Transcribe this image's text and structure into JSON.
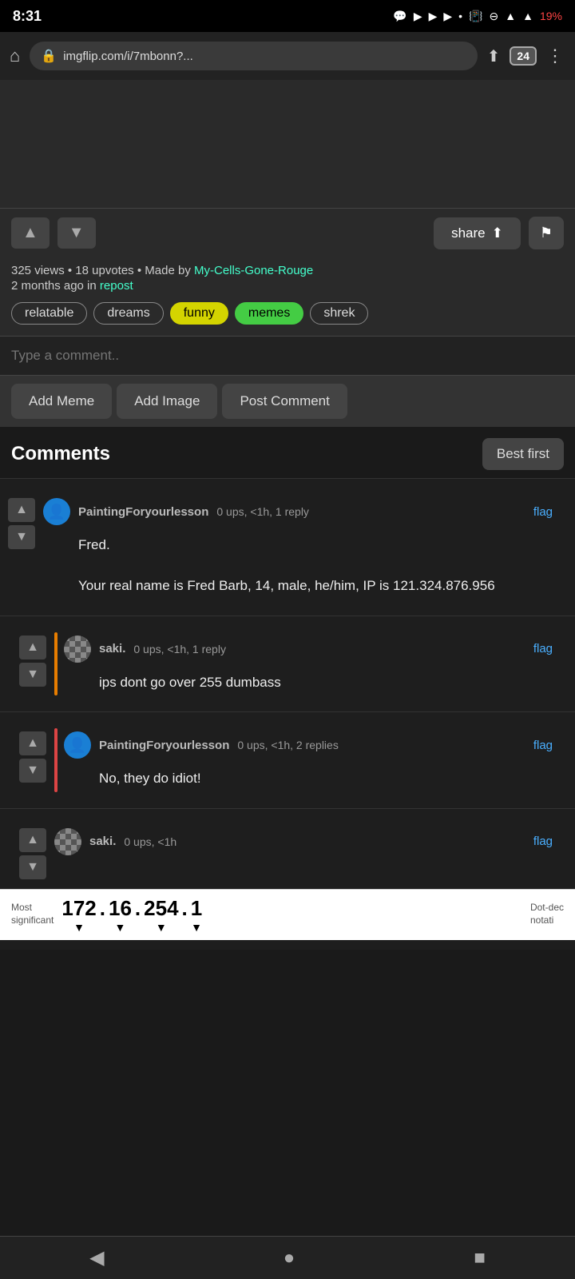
{
  "statusBar": {
    "time": "8:31",
    "battery": "19%",
    "tabCount": "24"
  },
  "browserBar": {
    "url": "imgflip.com/i/7mbonn?...",
    "homeIcon": "⌂",
    "lockIcon": "🔒",
    "shareIcon": "⎙",
    "menuIcon": "⋮"
  },
  "postMeta": {
    "views": "325 views",
    "upvotes": "18 upvotes",
    "madeByLabel": "Made by",
    "madeByUser": "My-Cells-Gone-Rouge",
    "timeAgo": "2 months ago in",
    "channel": "repost"
  },
  "tags": [
    {
      "label": "relatable",
      "style": "plain"
    },
    {
      "label": "dreams",
      "style": "plain"
    },
    {
      "label": "funny",
      "style": "yellow"
    },
    {
      "label": "memes",
      "style": "green"
    },
    {
      "label": "shrek",
      "style": "plain"
    }
  ],
  "commentInput": {
    "placeholder": "Type a comment.."
  },
  "addButtons": {
    "addMeme": "Add Meme",
    "addImage": "Add Image",
    "postComment": "Post Comment"
  },
  "commentsSection": {
    "title": "Comments",
    "sortLabel": "Best first"
  },
  "comments": [
    {
      "user": "PaintingForyourlesson",
      "meta": "0 ups, <1h, 1 reply",
      "flagLabel": "flag",
      "avatarType": "blue",
      "body": "Fred.\n\nYour real name is Fred Barb, 14, male, he/him, IP is 121.324.876.956",
      "indentLevel": 0,
      "sideBar": null
    },
    {
      "user": "saki.",
      "meta": "0 ups, <1h, 1 reply",
      "flagLabel": "flag",
      "avatarType": "checker",
      "body": "ips dont go over 255 dumbass",
      "indentLevel": 1,
      "sideBar": "orange"
    },
    {
      "user": "PaintingForyourlesson",
      "meta": "0 ups, <1h, 2 replies",
      "flagLabel": "flag",
      "avatarType": "blue",
      "body": "No, they do idiot!",
      "indentLevel": 1,
      "sideBar": "red"
    },
    {
      "user": "saki.",
      "meta": "0 ups, <1h",
      "flagLabel": "flag",
      "avatarType": "checker",
      "body": "",
      "indentLevel": 1,
      "sideBar": null,
      "hasTooltip": true
    }
  ],
  "ipTooltip": {
    "mostSignificantLabel": "Most\nsignificant",
    "octets": [
      "172",
      "16",
      "254",
      "1"
    ],
    "dotDeciLabel": "Dot-dec\nnotati"
  },
  "navBar": {
    "back": "◀",
    "home": "●",
    "recent": "■"
  }
}
